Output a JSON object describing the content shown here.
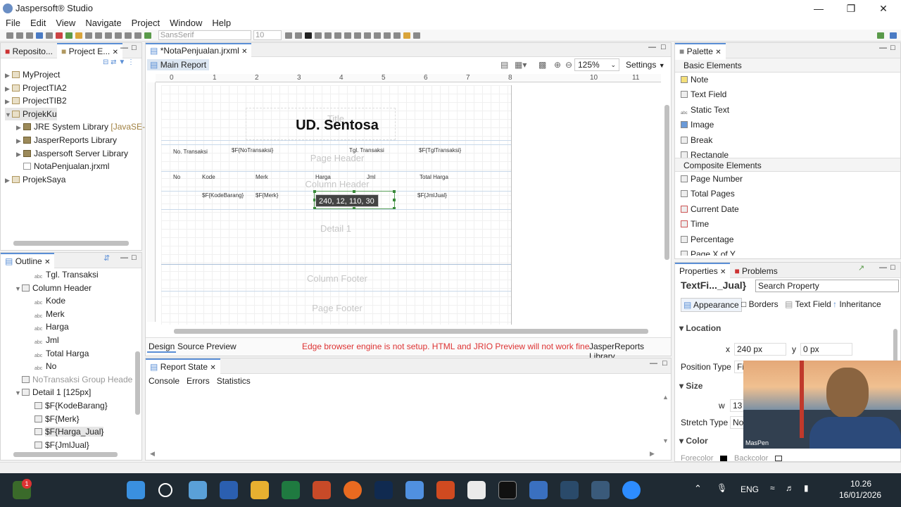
{
  "app": {
    "title": "Jaspersoft® Studio"
  },
  "menu": [
    "File",
    "Edit",
    "View",
    "Navigate",
    "Project",
    "Window",
    "Help"
  ],
  "toolbar": {
    "font_family": "SansSerif",
    "font_size": "10"
  },
  "project_panel": {
    "tabs": [
      "Reposito...",
      "Project E..."
    ],
    "tree": [
      {
        "label": "MyProject",
        "level": 0,
        "expanded": false
      },
      {
        "label": "ProjectTIA2",
        "level": 0,
        "expanded": false
      },
      {
        "label": "ProjectTIB2",
        "level": 0,
        "expanded": false
      },
      {
        "label": "ProjekKu",
        "level": 0,
        "expanded": true
      },
      {
        "label": "JRE System Library",
        "suffix": "[JavaSE-11",
        "level": 1
      },
      {
        "label": "JasperReports Library",
        "level": 1
      },
      {
        "label": "Jaspersoft Server Library",
        "level": 1
      },
      {
        "label": "NotaPenjualan.jrxml",
        "level": 1
      },
      {
        "label": "ProjekSaya",
        "level": 0,
        "expanded": false
      }
    ]
  },
  "outline": {
    "title": "Outline",
    "items": [
      {
        "label": "Tgl. Transaksi",
        "level": 2
      },
      {
        "label": "Column Header",
        "level": 1,
        "expanded": true
      },
      {
        "label": "Kode",
        "level": 2
      },
      {
        "label": "Merk",
        "level": 2
      },
      {
        "label": "Harga",
        "level": 2
      },
      {
        "label": "Jml",
        "level": 2
      },
      {
        "label": "Total Harga",
        "level": 2
      },
      {
        "label": "No",
        "level": 2
      },
      {
        "label": "NoTransaksi Group Heade",
        "level": 1
      },
      {
        "label": "Detail 1 [125px]",
        "level": 1,
        "expanded": true
      },
      {
        "label": "$F{KodeBarang}",
        "level": 2
      },
      {
        "label": "$F{Merk}",
        "level": 2
      },
      {
        "label": "$F{Harga_Jual}",
        "level": 2
      },
      {
        "label": "$F{JmlJual}",
        "level": 2
      }
    ]
  },
  "editor": {
    "tab": "*NotaPenjualan.jrxml",
    "subtab": "Main Report",
    "zoom": "125%",
    "settings": "Settings",
    "ruler": [
      "0",
      "1",
      "2",
      "3",
      "4",
      "5",
      "6",
      "7",
      "8",
      "10",
      "11"
    ],
    "report": {
      "title": "UD. Sentosa",
      "band_title": "Title",
      "band_page_header": "Page Header",
      "band_column_header": "Column Header",
      "band_detail": "Detail 1",
      "band_column_footer": "Column Footer",
      "band_page_footer": "Page Footer",
      "no_transaksi_label": "No. Transaksi",
      "no_transaksi_field": "$F{NoTransaksi}",
      "tgl_transaksi_label": "Tgl. Transaksi",
      "tgl_transaksi_field": "$F{TglTransaksi}",
      "col_no": "No",
      "col_kode": "Kode",
      "col_merk": "Merk",
      "col_harga": "Harga",
      "col_jml": "Jml",
      "col_total": "Total Harga",
      "f_kode": "$F{KodeBarang}",
      "f_merk": "$F{Merk}",
      "f_jml": "$F{JmlJual}",
      "tooltip": "240, 12, 110, 30"
    },
    "bottom_tabs": [
      "Design",
      "Source",
      "Preview"
    ],
    "warning": "Edge browser engine is not setup. HTML and JRIO Preview will not work fine",
    "jr_library": "JasperReports Library"
  },
  "report_state": {
    "tab": "Report State",
    "subtabs": [
      "Console",
      "Errors",
      "Statistics"
    ]
  },
  "palette": {
    "title": "Palette",
    "basic_header": "Basic Elements",
    "basic": [
      "Note",
      "Text Field",
      "Static Text",
      "Image",
      "Break",
      "Rectangle"
    ],
    "composite_header": "Composite Elements",
    "composite": [
      "Page Number",
      "Total Pages",
      "Current Date",
      "Time",
      "Percentage",
      "Page X of Y"
    ]
  },
  "properties": {
    "tabs": [
      "Properties",
      "Problems"
    ],
    "element": "TextFi..._Jual}",
    "search_placeholder": "Search Property",
    "subtabs": [
      "Appearance",
      "Borders",
      "Text Field",
      "Inheritance"
    ],
    "location_header": "Location",
    "x_label": "x",
    "x_value": "240 px",
    "y_label": "y",
    "y_value": "0 px",
    "position_type_label": "Position Type",
    "position_type_value": "Fi",
    "size_header": "Size",
    "w_label": "w",
    "w_value": "13",
    "stretch_type_label": "Stretch Type",
    "stretch_type_value": "No",
    "color_header": "Color",
    "forecolor_label": "Forecolor",
    "backcolor_label": "Backcolor"
  },
  "webcam": {
    "name": "MasPen"
  },
  "taskbar": {
    "lang": "ENG",
    "time": "10.26",
    "date": "16/01/2026",
    "badge": "1"
  }
}
